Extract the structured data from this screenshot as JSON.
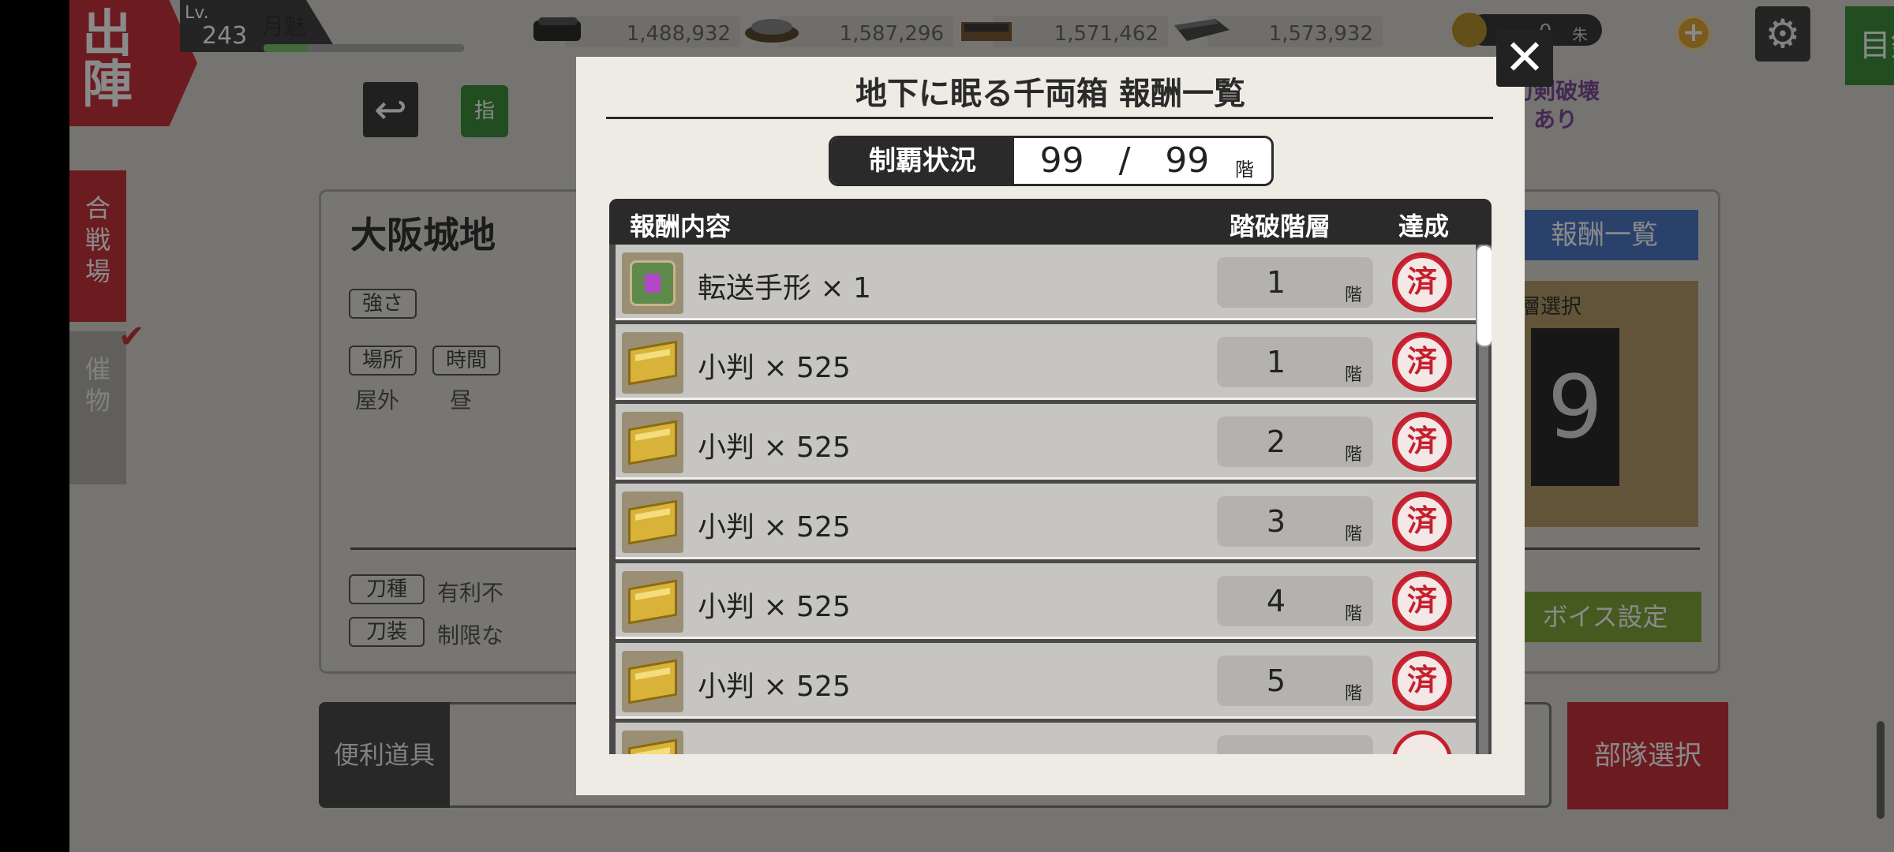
{
  "header": {
    "sortie_label": "出陣",
    "level_label": "Lv.",
    "level": "243",
    "player_name": "月魅",
    "resources": [
      {
        "icon": "charcoal-icon",
        "value": "1,488,932"
      },
      {
        "icon": "steel-icon",
        "value": "1,587,296"
      },
      {
        "icon": "cooling-material-icon",
        "value": "1,571,462"
      },
      {
        "icon": "whetstone-icon",
        "value": "1,573,932"
      }
    ],
    "koban_value": "0",
    "koban_unit": "朱",
    "catalog_label": "目録"
  },
  "sidebar": {
    "battle_tab": "合戦場",
    "event_tab": "催物"
  },
  "stage": {
    "title": "大阪城地",
    "strength_label": "強さ",
    "location_label": "場所",
    "time_label": "時間",
    "location_value": "屋外",
    "time_value": "昼",
    "sword_type_label": "刀種",
    "sword_type_value": "有利不",
    "equip_label": "刀装",
    "equip_value": "制限な",
    "floors_suffix": "階",
    "reward_list_button": "報酬一覧",
    "floor_select_label": "階層選択",
    "floor_digit": "9",
    "sword_break_label": "刀剣破壊\nあり",
    "voice_button": "ボイス設定",
    "tools_label": "便利道具",
    "party_button": "部隊選択",
    "pointer_label": "指"
  },
  "modal": {
    "title": "地下に眠る千両箱 報酬一覧",
    "status_label": "制覇状況",
    "status_value": "99　/　99",
    "status_unit": "階",
    "columns": {
      "content": "報酬内容",
      "floor": "踏破階層",
      "done": "達成"
    },
    "done_mark": "済",
    "floor_unit": "階",
    "rows": [
      {
        "icon": "transfer-pass-icon",
        "name": "転送手形 × 1",
        "floor": "1"
      },
      {
        "icon": "koban-icon",
        "name": "小判 × 525",
        "floor": "1"
      },
      {
        "icon": "koban-icon",
        "name": "小判 × 525",
        "floor": "2"
      },
      {
        "icon": "koban-icon",
        "name": "小判 × 525",
        "floor": "3"
      },
      {
        "icon": "koban-icon",
        "name": "小判 × 525",
        "floor": "4"
      },
      {
        "icon": "koban-icon",
        "name": "小判 × 525",
        "floor": "5"
      }
    ],
    "close_icon": "close-icon"
  },
  "colors": {
    "accent_red": "#c8343b",
    "seal_red": "#c61f2e",
    "catalog_green": "#3e8e3e",
    "reward_blue": "#4c78c6",
    "voice_green": "#7ea63a"
  }
}
